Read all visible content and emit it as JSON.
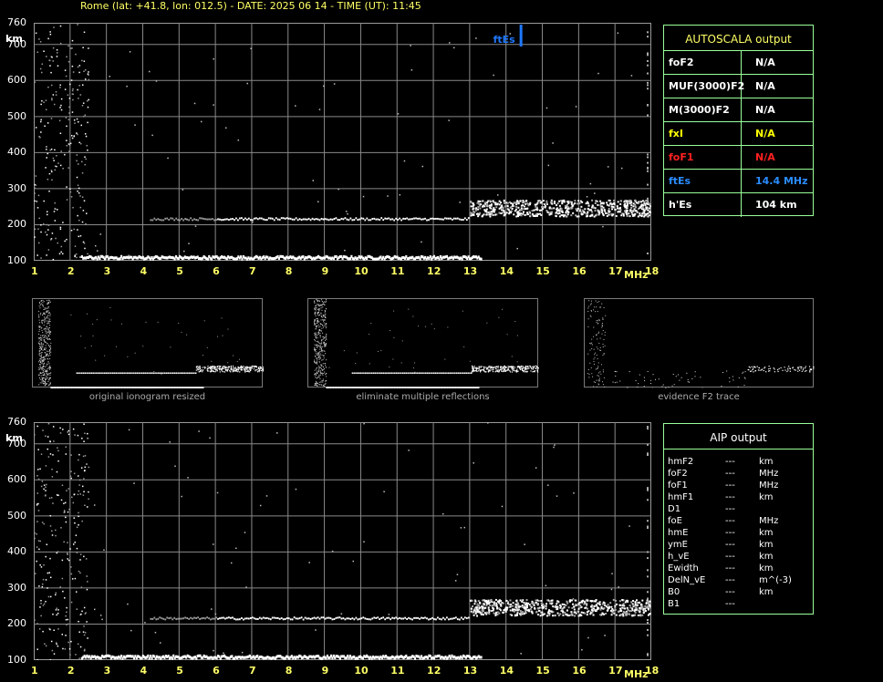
{
  "header": "Rome (lat: +41.8, lon: 012.5) - DATE: 2025 06 14 - TIME (UT): 11:45",
  "y_unit": "km",
  "x_unit": "MHz",
  "y_ticks": [
    "760",
    "700",
    "600",
    "500",
    "400",
    "300",
    "200",
    "100"
  ],
  "x_ticks": [
    "1",
    "2",
    "3",
    "4",
    "5",
    "6",
    "7",
    "8",
    "9",
    "10",
    "11",
    "12",
    "13",
    "14",
    "15",
    "16",
    "17",
    "18"
  ],
  "marker_label": "ftEs",
  "autoscala": {
    "title": "AUTOSCALA output",
    "rows": [
      {
        "key": "foF2",
        "value": "N/A",
        "color": "#ffffff"
      },
      {
        "key": "MUF(3000)F2",
        "value": "N/A",
        "color": "#ffffff"
      },
      {
        "key": "M(3000)F2",
        "value": "N/A",
        "color": "#ffffff"
      },
      {
        "key": "fxI",
        "value": "N/A",
        "color": "#ffff00"
      },
      {
        "key": "foF1",
        "value": "N/A",
        "color": "#ff2020"
      },
      {
        "key": "ftEs",
        "value": "14.4 MHz",
        "color": "#2a8cff"
      },
      {
        "key": "h'Es",
        "value": "104     km",
        "color": "#ffffff"
      }
    ]
  },
  "thumbnails": [
    {
      "caption": "original ionogram resized"
    },
    {
      "caption": "eliminate multiple reflections"
    },
    {
      "caption": "evidence F2 trace"
    }
  ],
  "aip": {
    "title": "AIP output",
    "rows": [
      {
        "key": "hmF2",
        "value": "---",
        "unit": "km"
      },
      {
        "key": "foF2",
        "value": "---",
        "unit": "MHz"
      },
      {
        "key": "foF1",
        "value": "---",
        "unit": "MHz"
      },
      {
        "key": "hmF1",
        "value": "---",
        "unit": "km"
      },
      {
        "key": "D1",
        "value": "---",
        "unit": ""
      },
      {
        "key": "foE",
        "value": "---",
        "unit": "MHz"
      },
      {
        "key": "hmE",
        "value": "---",
        "unit": "km"
      },
      {
        "key": "ymE",
        "value": "---",
        "unit": "km"
      },
      {
        "key": "h_vE",
        "value": "---",
        "unit": "km"
      },
      {
        "key": "Ewidth",
        "value": "---",
        "unit": "km"
      },
      {
        "key": "DelN_vE",
        "value": "---",
        "unit": "m^(-3)"
      },
      {
        "key": "B0",
        "value": "---",
        "unit": "km"
      },
      {
        "key": "B1",
        "value": "---",
        "unit": ""
      }
    ]
  },
  "colors": {
    "grid": "#8a8a8a",
    "panel_border": "#9aff9a",
    "tick_x": "#ffff66",
    "marker": "#1e78ff"
  }
}
